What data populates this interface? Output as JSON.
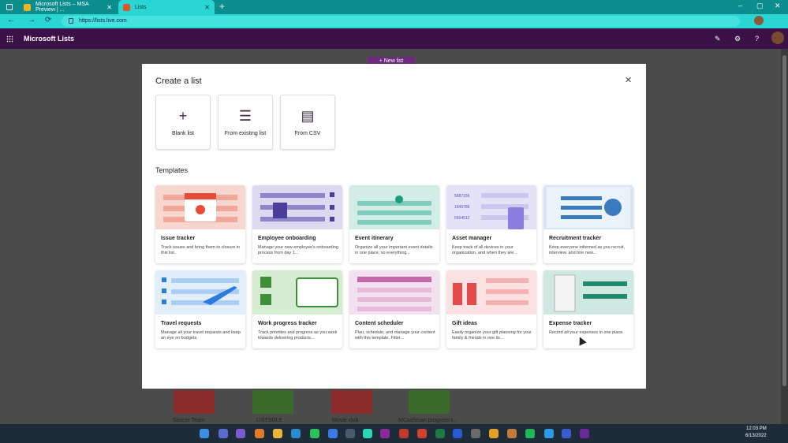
{
  "browser": {
    "tabs": [
      {
        "label": "Microsoft Lists – MSA Preview | ...",
        "active": false
      },
      {
        "label": "Lists",
        "active": true
      }
    ],
    "url": "https://lists.live.com"
  },
  "app": {
    "name": "Microsoft Lists",
    "new_list_label": "+ New list"
  },
  "modal": {
    "title": "Create a list",
    "close": "✕",
    "sources": [
      {
        "label": "Blank list",
        "icon": "plus-icon"
      },
      {
        "label": "From existing list",
        "icon": "list-lines-icon"
      },
      {
        "label": "From CSV",
        "icon": "csv-file-icon"
      }
    ],
    "templates_heading": "Templates",
    "templates": [
      {
        "name": "Issue tracker",
        "desc": "Track issues and bring them to closure in this list."
      },
      {
        "name": "Employee onboarding",
        "desc": "Manage your new employee's onboarding process from day 1..."
      },
      {
        "name": "Event itinerary",
        "desc": "Organize all your important event details in one place, so everything..."
      },
      {
        "name": "Asset manager",
        "desc": "Keep track of all devices in your organization, and when they are..."
      },
      {
        "name": "Recruitment tracker",
        "desc": "Keep everyone informed as you recruit, interview, and hire new..."
      },
      {
        "name": "Travel requests",
        "desc": "Manage all your travel requests and keep an eye on budgets."
      },
      {
        "name": "Work progress tracker",
        "desc": "Track priorities and progress as you work towards delivering products..."
      },
      {
        "name": "Content scheduler",
        "desc": "Plan, schedule, and manage your content with this template. Filter..."
      },
      {
        "name": "Gift ideas",
        "desc": "Easily organize your gift planning for your family & friends in one lis..."
      },
      {
        "name": "Expense tracker",
        "desc": "Record all your expenses in one place."
      }
    ],
    "asset_numbers": [
      "5687156",
      "1649786",
      "5564512"
    ]
  },
  "background_lists": [
    "Soccer Team",
    "LISTSDLE",
    "Movie club",
    "MCashman progress t..."
  ],
  "clock": {
    "time": "12:03 PM",
    "date": "6/13/2022"
  },
  "colors": {
    "accent": "#3b1147",
    "browser": "#2ad6d4"
  }
}
